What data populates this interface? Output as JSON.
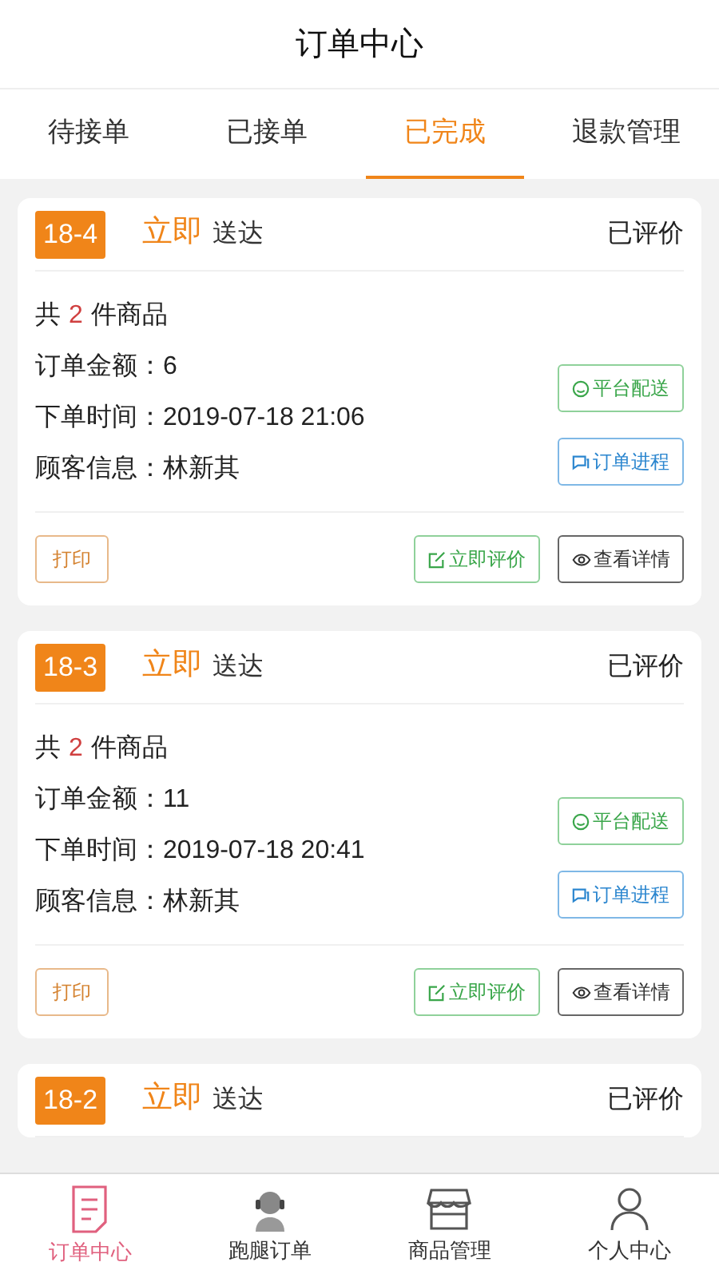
{
  "header": {
    "title": "订单中心"
  },
  "tabs": [
    {
      "label": "待接单",
      "selected": false
    },
    {
      "label": "已接单",
      "selected": false
    },
    {
      "label": "已完成",
      "selected": true
    },
    {
      "label": "退款管理",
      "selected": false
    }
  ],
  "orders": [
    {
      "number": "18-4",
      "speed": "立即",
      "delivery": "送达",
      "status": "已评价",
      "items_prefix": "共",
      "items_count": "2",
      "items_suffix": "件商品",
      "fields": [
        {
          "label": "订单金额：",
          "value": "6"
        },
        {
          "label": "下单时间：",
          "value": "2019-07-18 21:06"
        },
        {
          "label": "顾客信息：",
          "value": "林新其"
        }
      ],
      "side_buttons": [
        {
          "kind": "delivery",
          "label": "平台配送"
        },
        {
          "kind": "progress",
          "label": "订单进程"
        }
      ],
      "print_button": "打印",
      "action_buttons": [
        {
          "kind": "review",
          "label": "立即评价"
        },
        {
          "kind": "details",
          "label": "查看详情"
        }
      ]
    },
    {
      "number": "18-3",
      "speed": "立即",
      "delivery": "送达",
      "status": "已评价",
      "items_prefix": "共",
      "items_count": "2",
      "items_suffix": "件商品",
      "fields": [
        {
          "label": "订单金额：",
          "value": "11"
        },
        {
          "label": "下单时间：",
          "value": "2019-07-18 20:41"
        },
        {
          "label": "顾客信息：",
          "value": "林新其"
        }
      ],
      "side_buttons": [
        {
          "kind": "delivery",
          "label": "平台配送"
        },
        {
          "kind": "progress",
          "label": "订单进程"
        }
      ],
      "print_button": "打印",
      "action_buttons": [
        {
          "kind": "review",
          "label": "立即评价"
        },
        {
          "kind": "details",
          "label": "查看详情"
        }
      ]
    },
    {
      "number": "18-2",
      "speed": "立即",
      "delivery": "送达",
      "status": "已评价"
    }
  ],
  "bottom_nav": [
    {
      "kind": "orders",
      "label": "订单中心",
      "selected": true
    },
    {
      "kind": "courier",
      "label": "跑腿订单",
      "selected": false
    },
    {
      "kind": "store",
      "label": "商品管理",
      "selected": false
    },
    {
      "kind": "person",
      "label": "个人中心",
      "selected": false
    }
  ]
}
